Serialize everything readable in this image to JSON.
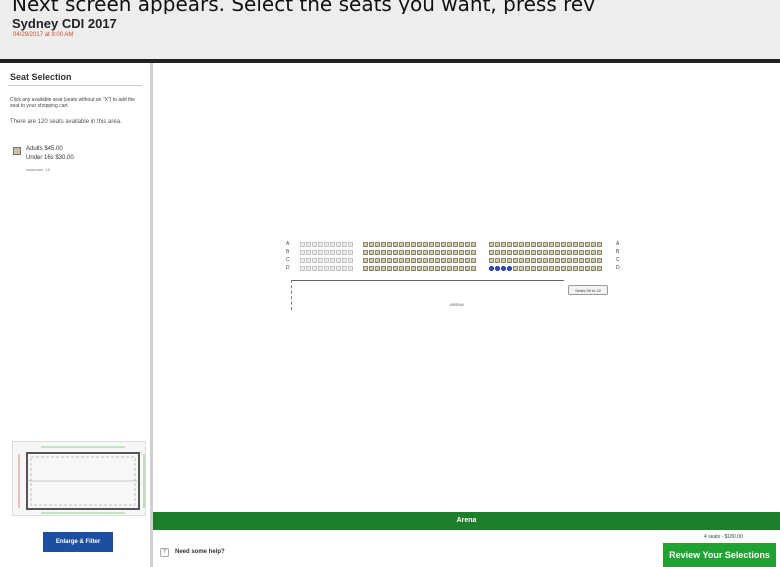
{
  "instruction": "Next screen appears. Select the seats you want, press rev",
  "event": {
    "title": "Sydney CDI 2017",
    "date": "04/29/2017 at 9:00 AM"
  },
  "sidebar": {
    "title": "Seat Selection",
    "note": "Click any available seat (seats without an \"X\") to add the seat to your shopping cart.",
    "available": "There are 120 seats available in this area.",
    "prices": {
      "adults": "Adults $45.00",
      "under16": "Under 16s $30.00",
      "maximum": "maximum: 10"
    },
    "enlarge_label": "Enlarge & Filter"
  },
  "map": {
    "rows": [
      "A",
      "B",
      "C",
      "D"
    ],
    "stage_label": "ARENA",
    "tooltip": "Seats 39 to 42",
    "blocks": [
      {
        "cols": 9,
        "state": "sold"
      },
      {
        "cols": 19,
        "state": "available"
      },
      {
        "cols": 19,
        "state": "available"
      }
    ],
    "selected": {
      "block": 2,
      "row": 3,
      "seats": [
        0,
        1,
        2,
        3
      ]
    }
  },
  "section_bar": "Arena",
  "footer": {
    "help": "Need some help?",
    "help_icon": "?",
    "cart_summary": "4 seats - $180.00",
    "review_label": "Review Your Selections"
  },
  "colors": {
    "accent_green": "#1d7f2a",
    "button_green": "#1fa332",
    "button_blue": "#1d4fa0",
    "date_red": "#d24a2b",
    "selected_seat": "#2f4ed0"
  }
}
